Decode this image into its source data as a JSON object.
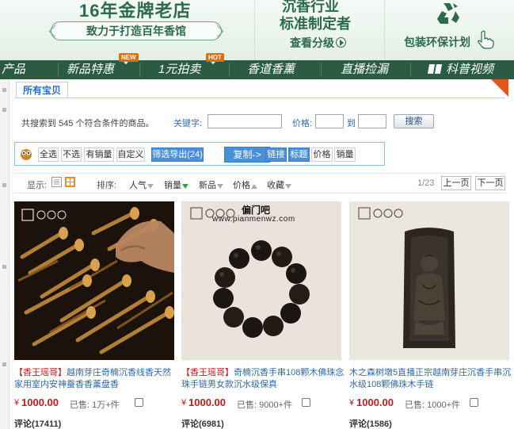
{
  "banner": {
    "left_title": "16年金牌老店",
    "left_slogan": "致力于打造百年香馆",
    "mid_line1": "沉香行业",
    "mid_line2": "标准制定者",
    "mid_link": "查看分级",
    "right_text": "包装环保计划"
  },
  "nav": {
    "items": [
      {
        "label": "产品"
      },
      {
        "label": "新品特惠",
        "badge": "NEW"
      },
      {
        "label": "1元拍卖",
        "badge": "HOT"
      },
      {
        "label": "香道香薰"
      },
      {
        "label": "直播捡漏"
      },
      {
        "label": "科普视频"
      }
    ]
  },
  "header": {
    "tab": "所有宝贝"
  },
  "search": {
    "total_text": "共搜索到 545 个符合条件的商品。",
    "keyword_label": "关键字:",
    "keyword_value": "",
    "price_label": "价格:",
    "to_label": "到",
    "price_from": "",
    "price_to": "",
    "button": "搜索"
  },
  "toolbar": {
    "select_all": "全选",
    "select_none": "不选",
    "has_sales": "有销量",
    "custom": "自定义",
    "filter_export": "筛选导出(24)",
    "copy": "复制->",
    "link": "链接",
    "title": "标题",
    "price": "价格",
    "sales": "销量"
  },
  "sort": {
    "display_label": "显示:",
    "sort_label": "排序:",
    "options": [
      "人气",
      "销量",
      "新品",
      "价格",
      "收藏"
    ],
    "page_indicator": "1/23",
    "prev": "上一页",
    "next": "下一页"
  },
  "watermark": {
    "line1": "偏门吧",
    "line2": "www.pianmenwz.com"
  },
  "products": [
    {
      "tag": "【香王瑶哥】",
      "title": "越南芽庄奇楠沉香线香天然家用室内安神蚕香香薰盘香",
      "currency": "¥",
      "price": "1000.00",
      "sold": "已售: 1万+件",
      "reviews": "评论(17411)"
    },
    {
      "tag": "【香王瑶哥】",
      "title": "奇楠沉香手串108颗木佛珠念珠手链男女款沉水级保真",
      "currency": "¥",
      "price": "1000.00",
      "sold": "已售: 9000+件",
      "reviews": "评论(6981)"
    },
    {
      "tag": "",
      "title": "木之森树墩5直播正宗越南芽庄沉香手串沉水级108颗佛珠木手链",
      "currency": "¥",
      "price": "1000.00",
      "sold": "已售: 1000+件",
      "reviews": "评论(1586)"
    }
  ]
}
